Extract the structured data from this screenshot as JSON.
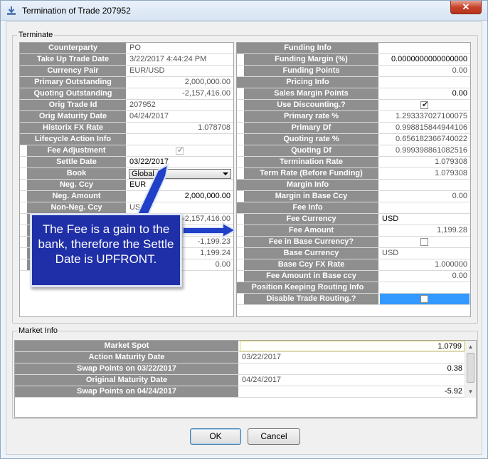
{
  "window": {
    "title": "Termination of Trade 207952",
    "close_glyph": "✕"
  },
  "terminate_group": {
    "label": "Terminate"
  },
  "left_rows": [
    {
      "label": "Counterparty",
      "value": "PO",
      "align": "l"
    },
    {
      "label": "Take Up Trade Date",
      "value": "3/22/2017 4:44:24 PM",
      "align": "l"
    },
    {
      "label": "Currency Pair",
      "value": "EUR/USD",
      "align": "l"
    },
    {
      "label": "Primary Outstanding",
      "value": "2,000,000.00",
      "align": "r"
    },
    {
      "label": "Quoting Outstanding",
      "value": "-2,157,416.00",
      "align": "r"
    },
    {
      "label": "Orig Trade Id",
      "value": "207952",
      "align": "l"
    },
    {
      "label": "Orig Maturity Date",
      "value": "04/24/2017",
      "align": "l"
    },
    {
      "label": "Historix FX Rate",
      "value": "1.078708",
      "align": "r"
    },
    {
      "label": "Lifecycle Action Info",
      "value": "",
      "align": "l"
    },
    {
      "label": "Fee Adjustment",
      "value": "",
      "type": "checkbox",
      "checked": true,
      "disabled": true,
      "indent": true
    },
    {
      "label": "Settle Date",
      "value": "03/22/2017",
      "align": "l",
      "black": true,
      "indent": true
    },
    {
      "label": "Book",
      "value": "Global",
      "type": "combo",
      "indent": true
    },
    {
      "label": "Neg. Ccy",
      "value": "EUR",
      "align": "l",
      "black": true,
      "indent": true
    },
    {
      "label": "Neg. Amount",
      "value": "2,000,000.00",
      "align": "r",
      "black": true,
      "indent": true
    },
    {
      "label": "Non-Neg. Ccy",
      "value": "USD",
      "align": "l",
      "indent": true
    },
    {
      "label": "",
      "value": "-2,157,416.00",
      "align": "r",
      "indent": true
    },
    {
      "label": "",
      "value": "",
      "align": "r",
      "indent": true
    },
    {
      "label": "",
      "value": "-1,199.23",
      "align": "r",
      "indent": true
    },
    {
      "label": "",
      "value": "1,199.24",
      "align": "r",
      "indent": true
    },
    {
      "label": "",
      "value": "0.00",
      "align": "r",
      "indent": true
    }
  ],
  "right_rows": [
    {
      "label": "Funding Info",
      "value": ""
    },
    {
      "label": "Funding Margin (%)",
      "value": "0.0000000000000000",
      "align": "r",
      "black": true,
      "indent": true
    },
    {
      "label": "Funding Points",
      "value": "0.00",
      "align": "r",
      "indent": true
    },
    {
      "label": "Pricing Info",
      "value": ""
    },
    {
      "label": "Sales Margin Points",
      "value": "0.00",
      "align": "r",
      "black": true,
      "indent": true
    },
    {
      "label": "Use Discounting.?",
      "value": "",
      "type": "checkbox",
      "checked": true,
      "indent": true
    },
    {
      "label": "Primary rate %",
      "value": "1.293337027100075",
      "align": "r",
      "indent": true
    },
    {
      "label": "Primary Df",
      "value": "0.998815844944106",
      "align": "r",
      "indent": true
    },
    {
      "label": "Quoting rate %",
      "value": "0.656182366740022",
      "align": "r",
      "indent": true
    },
    {
      "label": "Quoting Df",
      "value": "0.999398861082516",
      "align": "r",
      "indent": true
    },
    {
      "label": "Termination Rate",
      "value": "1.079308",
      "align": "r",
      "indent": true
    },
    {
      "label": "Term Rate (Before Funding)",
      "value": "1.079308",
      "align": "r",
      "indent": true
    },
    {
      "label": "Margin Info",
      "value": ""
    },
    {
      "label": "Margin in Base Ccy",
      "value": "0.00",
      "align": "r",
      "indent": true
    },
    {
      "label": "Fee Info",
      "value": ""
    },
    {
      "label": "Fee Currency",
      "value": "USD",
      "align": "l",
      "black": true,
      "indent": true
    },
    {
      "label": "Fee Amount",
      "value": "1,199.28",
      "align": "r",
      "indent": true
    },
    {
      "label": "Fee in Base Currency?",
      "value": "",
      "type": "checkbox",
      "checked": false,
      "indent": true
    },
    {
      "label": "Base Currency",
      "value": "USD",
      "align": "l",
      "indent": true
    },
    {
      "label": "Base Ccy FX Rate",
      "value": "1.000000",
      "align": "r",
      "indent": true
    },
    {
      "label": "Fee Amount in Base ccy",
      "value": "0.00",
      "align": "r",
      "indent": true
    },
    {
      "label": "Position Keeping Routing Info",
      "value": ""
    },
    {
      "label": "Disable Trade Routing.?",
      "value": "",
      "type": "checkbox",
      "checked": false,
      "highlight": true,
      "indent": true
    }
  ],
  "market_group": {
    "label": "Market Info"
  },
  "market_rows": [
    {
      "label": "Market Spot",
      "value": "1.0799",
      "align": "r",
      "black": true,
      "spot": true
    },
    {
      "label": "Action Maturity Date",
      "value": "03/22/2017",
      "align": "l"
    },
    {
      "label": "Swap Points on 03/22/2017",
      "value": "0.38",
      "align": "r",
      "black": true
    },
    {
      "label": "Original Maturity Date",
      "value": "04/24/2017",
      "align": "l"
    },
    {
      "label": "Swap Points on 04/24/2017",
      "value": "-5.92",
      "align": "r",
      "black": true
    }
  ],
  "buttons": {
    "ok": "OK",
    "cancel": "Cancel"
  },
  "callout": {
    "text": "The Fee is a gain to the bank, therefore the Settle Date is UPFRONT."
  },
  "glyphs": {
    "scroll_up": "▲",
    "scroll_down": "▼",
    "check": "✔"
  },
  "icons": {
    "title": "download-arrow-icon"
  },
  "colors": {
    "label_bg": "#8f8f8f",
    "callout_bg": "#1f2fa8",
    "highlight": "#3399ff"
  }
}
